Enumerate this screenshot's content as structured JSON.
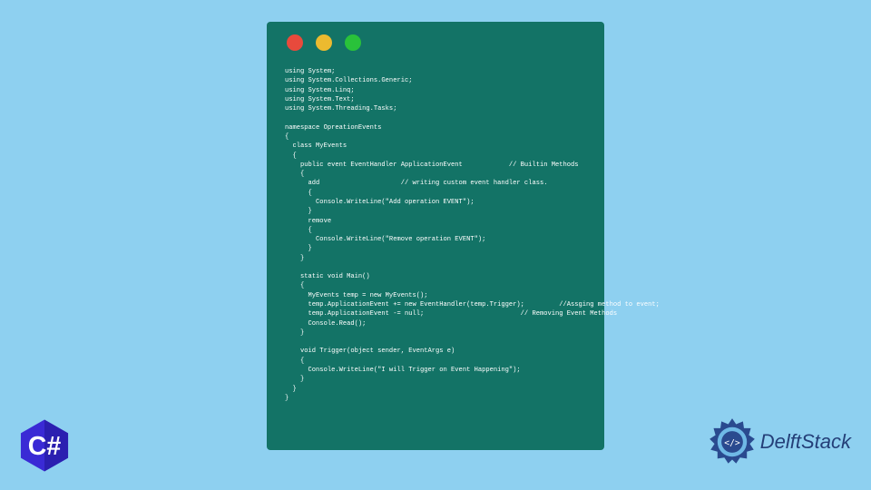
{
  "window": {
    "traffic_colors": {
      "red": "#e84a3c",
      "yellow": "#ecba2f",
      "green": "#29c23a"
    },
    "background": "#137366"
  },
  "code_text": "using System;\nusing System.Collections.Generic;\nusing System.Linq;\nusing System.Text;\nusing System.Threading.Tasks;\n\nnamespace OpreationEvents\n{\n  class MyEvents\n  {\n    public event EventHandler ApplicationEvent            // Builtin Methods\n    {\n      add                     // writing custom event handler class.\n      {\n        Console.WriteLine(\"Add operation EVENT\");\n      }\n      remove\n      {\n        Console.WriteLine(\"Remove operation EVENT\");\n      }\n    }\n\n    static void Main()\n    {\n      MyEvents temp = new MyEvents();\n      temp.ApplicationEvent += new EventHandler(temp.Trigger);         //Assging method to event;\n      temp.ApplicationEvent -= null;                         // Removing Event Methods\n      Console.Read();\n    }\n\n    void Trigger(object sender, EventArgs e)\n    {\n      Console.WriteLine(\"I will Trigger on Event Happening\");\n    }\n  }\n}",
  "badge": {
    "label": "C#"
  },
  "brand": {
    "name": "DelftStack"
  }
}
